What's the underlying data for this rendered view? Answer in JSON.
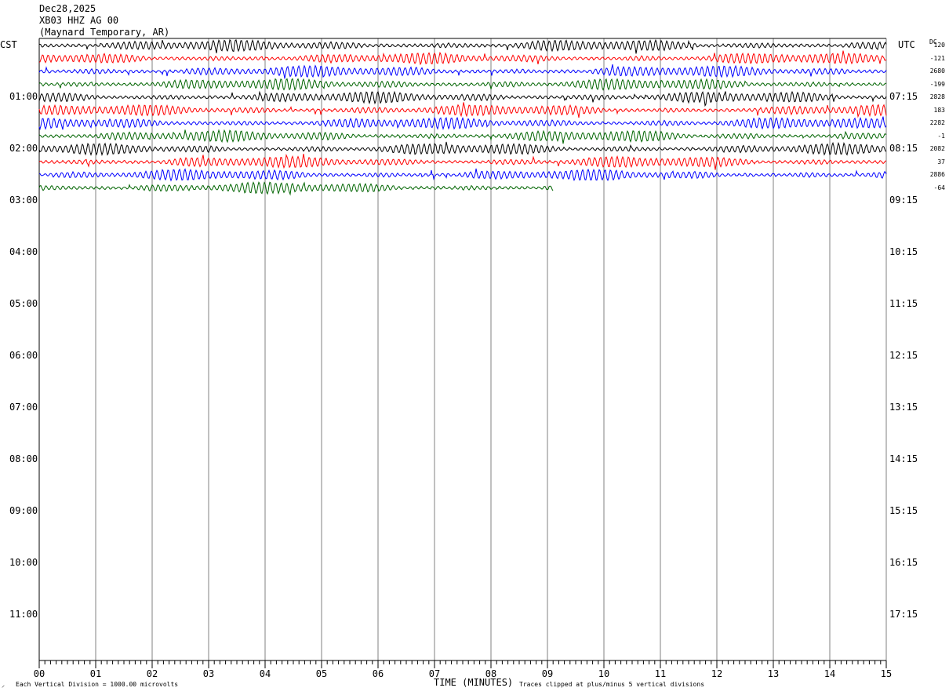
{
  "header": {
    "date": "Dec28,2025",
    "station": "XB03 HHZ AG 00",
    "location": "(Maynard Temporary, AR)"
  },
  "left_tz": "CST",
  "right_tz": "UTC",
  "dc_label": "DC",
  "left_hours": [
    "01:00",
    "02:00",
    "03:00",
    "04:00",
    "05:00",
    "06:00",
    "07:00",
    "08:00",
    "09:00",
    "10:00",
    "11:00"
  ],
  "right_hours": [
    "07:15",
    "08:15",
    "09:15",
    "10:15",
    "11:15",
    "12:15",
    "13:15",
    "14:15",
    "15:15",
    "16:15",
    "17:15"
  ],
  "dc_offsets": [
    "120",
    "-121",
    "2680",
    "-199",
    "2828",
    "183",
    "2282",
    "-1",
    "2082",
    "37",
    "2886",
    "-64"
  ],
  "x_ticks": [
    "00",
    "01",
    "02",
    "03",
    "04",
    "05",
    "06",
    "07",
    "08",
    "09",
    "10",
    "11",
    "12",
    "13",
    "14",
    "15"
  ],
  "footer": {
    "left": "Each Vertical Division = 1000.00 microvolts",
    "center": "TIME (MINUTES)",
    "right": "Traces clipped at plus/minus 5 vertical divisions"
  },
  "chart_data": {
    "type": "line",
    "title": "XB03 HHZ AG 00",
    "xlabel": "TIME (MINUTES)",
    "ylabel": "",
    "xlim": [
      0,
      15
    ],
    "trace_colors": [
      "#000000",
      "#ff0000",
      "#0000ff",
      "#006400"
    ],
    "minutes_per_trace": 15,
    "traces_recorded": 12,
    "last_trace_end_minute": 9.1,
    "series": [
      {
        "start_cst": "00:00",
        "dc": "120",
        "color": "#000000",
        "end_minute": 15
      },
      {
        "start_cst": "00:15",
        "dc": "-121",
        "color": "#ff0000",
        "end_minute": 15
      },
      {
        "start_cst": "00:30",
        "dc": "2680",
        "color": "#0000ff",
        "end_minute": 15
      },
      {
        "start_cst": "00:45",
        "dc": "-199",
        "color": "#006400",
        "end_minute": 15
      },
      {
        "start_cst": "01:00",
        "dc": "2828",
        "color": "#000000",
        "end_minute": 15
      },
      {
        "start_cst": "01:15",
        "dc": "183",
        "color": "#ff0000",
        "end_minute": 15
      },
      {
        "start_cst": "01:30",
        "dc": "2282",
        "color": "#0000ff",
        "end_minute": 15
      },
      {
        "start_cst": "01:45",
        "dc": "-1",
        "color": "#006400",
        "end_minute": 15
      },
      {
        "start_cst": "02:00",
        "dc": "2082",
        "color": "#000000",
        "end_minute": 15
      },
      {
        "start_cst": "02:15",
        "dc": "37",
        "color": "#ff0000",
        "end_minute": 15
      },
      {
        "start_cst": "02:30",
        "dc": "2886",
        "color": "#0000ff",
        "end_minute": 15
      },
      {
        "start_cst": "02:45",
        "dc": "-64",
        "color": "#006400",
        "end_minute": 9.1
      }
    ]
  }
}
